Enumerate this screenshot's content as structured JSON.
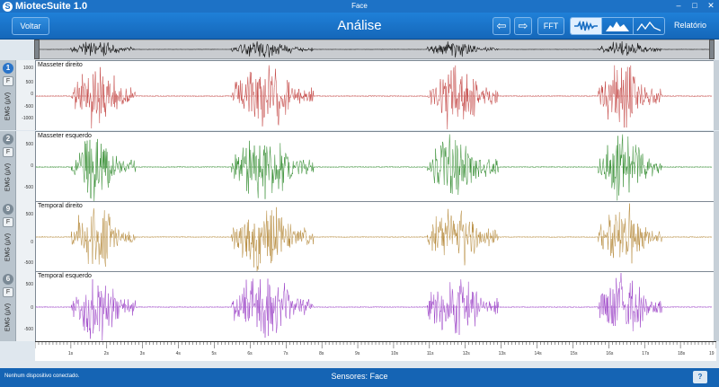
{
  "window": {
    "app_name": "MiotecSuite 1.0",
    "title": "Face",
    "controls": [
      "–",
      "□",
      "✕"
    ]
  },
  "toolbar": {
    "back_label": "Voltar",
    "page_title": "Análise",
    "fft_label": "FFT",
    "report_label": "Relatório",
    "view_modes": [
      {
        "icon": "waveform-icon",
        "active": true
      },
      {
        "icon": "area-spectrum-icon",
        "active": false
      },
      {
        "icon": "line-spectrum-icon",
        "active": false
      }
    ]
  },
  "channels": [
    {
      "number": "1",
      "name": "Masseter direito",
      "unit": "EMG (µV)",
      "color": "#c2413f",
      "badge_color": "#2a74c9",
      "ticks": [
        "1000",
        "500",
        "0",
        "-500",
        "-1000"
      ],
      "filter_label": "F"
    },
    {
      "number": "2",
      "name": "Masseter esquerdo",
      "unit": "EMG (µV)",
      "color": "#2f8a2c",
      "badge_color": "#7b8a96",
      "ticks": [
        "500",
        "0",
        "-500"
      ],
      "filter_label": "F"
    },
    {
      "number": "9",
      "name": "Temporal direito",
      "unit": "EMG (µV)",
      "color": "#b5893a",
      "badge_color": "#7b8a96",
      "ticks": [
        "500",
        "0",
        "-500"
      ],
      "filter_label": "F"
    },
    {
      "number": "6",
      "name": "Temporal esquerdo",
      "unit": "EMG (µV)",
      "color": "#9a3fc6",
      "badge_color": "#7b8a96",
      "ticks": [
        "500",
        "0",
        "-500"
      ],
      "filter_label": "F"
    }
  ],
  "time_axis": {
    "labels": [
      "1s",
      "2s",
      "3s",
      "4s",
      "5s",
      "6s",
      "7s",
      "8s",
      "9s",
      "10s",
      "11s",
      "12s",
      "13s",
      "14s",
      "15s",
      "16s",
      "17s",
      "18s",
      "19"
    ]
  },
  "signal": {
    "duration_s": 19,
    "bursts": [
      {
        "start_s": 1.0,
        "end_s": 2.8
      },
      {
        "start_s": 5.5,
        "end_s": 7.8
      },
      {
        "start_s": 11.0,
        "end_s": 13.0
      },
      {
        "start_s": 15.8,
        "end_s": 17.6
      }
    ]
  },
  "status": {
    "message": "Nenhum dispositivo conectado.",
    "sensors": "Sensores: Face",
    "help_label": "?"
  }
}
